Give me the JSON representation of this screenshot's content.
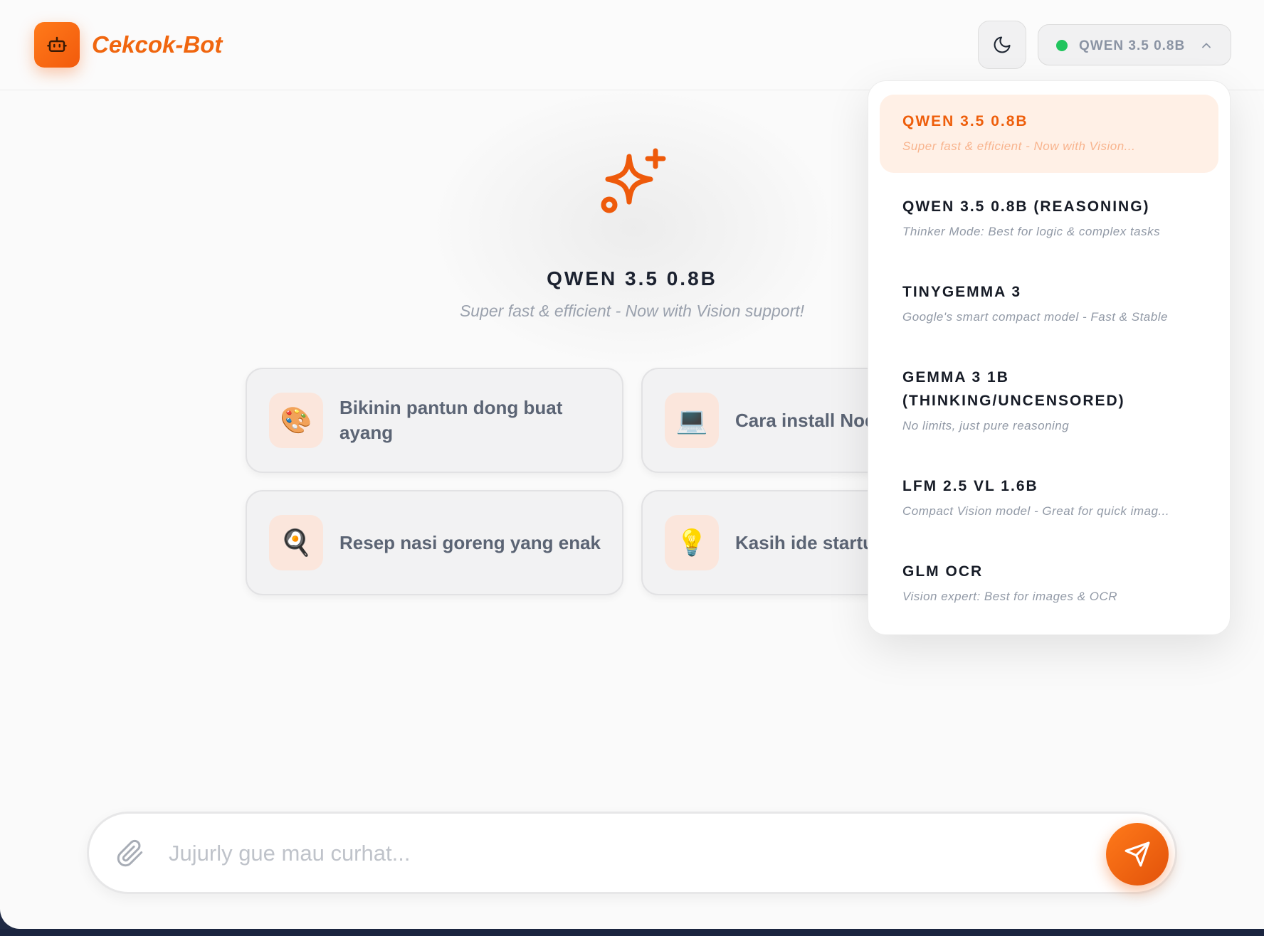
{
  "header": {
    "brand": "Cekcok-Bot",
    "logo_icon": "robot-icon",
    "theme_icon": "moon-icon",
    "model_selector": {
      "label": "QWEN 3.5 0.8B",
      "status_color": "#22c55e",
      "chevron_icon": "chevron-up-icon"
    }
  },
  "hero": {
    "icon": "sparkles-icon",
    "title": "QWEN 3.5 0.8B",
    "subtitle": "Super fast & efficient - Now with Vision support!"
  },
  "suggestions": [
    {
      "icon": "🎨",
      "icon_name": "palette-icon",
      "text": "Bikinin pantun dong buat ayang"
    },
    {
      "icon": "💻",
      "icon_name": "laptop-icon",
      "text": "Cara install Node.js"
    },
    {
      "icon": "🍳",
      "icon_name": "frying-pan-icon",
      "text": "Resep nasi goreng yang enak"
    },
    {
      "icon": "💡",
      "icon_name": "lightbulb-icon",
      "text": "Kasih ide startup unik dong"
    }
  ],
  "dropdown": {
    "models": [
      {
        "name": "QWEN 3.5 0.8B",
        "desc": "Super fast & efficient - Now with Vision...",
        "active": true
      },
      {
        "name": "QWEN 3.5 0.8B (REASONING)",
        "desc": "Thinker Mode: Best for logic & complex tasks",
        "active": false
      },
      {
        "name": "TINYGEMMA 3",
        "desc": "Google's smart compact model - Fast & Stable",
        "active": false
      },
      {
        "name": "GEMMA 3 1B (THINKING/UNCENSORED)",
        "desc": "No limits, just pure reasoning",
        "active": false
      },
      {
        "name": "LFM 2.5 VL 1.6B",
        "desc": "Compact Vision model - Great for quick imag...",
        "active": false
      },
      {
        "name": "GLM OCR",
        "desc": "Vision expert: Best for images & OCR",
        "active": false
      }
    ]
  },
  "chat": {
    "placeholder": "Jujurly gue mau curhat...",
    "attach_icon": "paperclip-icon",
    "send_icon": "send-icon"
  },
  "colors": {
    "accent": "#f0660f",
    "accent_light": "#fff0e6",
    "status_online": "#22c55e"
  }
}
